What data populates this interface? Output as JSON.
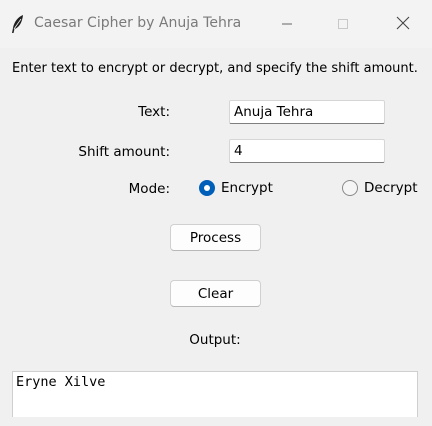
{
  "window": {
    "title": "Caesar Cipher by Anuja Tehra",
    "icon": "feather-icon",
    "controls": [
      "minimize-icon",
      "maximize-icon",
      "close-icon"
    ]
  },
  "instructions": "Enter text to encrypt or decrypt, and specify the shift amount.",
  "form": {
    "text_label": "Text:",
    "text_value": "Anuja Tehra",
    "shift_label": "Shift amount:",
    "shift_value": "4",
    "mode_label": "Mode:",
    "mode_options": [
      {
        "label": "Encrypt",
        "selected": true
      },
      {
        "label": "Decrypt",
        "selected": false
      }
    ]
  },
  "buttons": {
    "process_label": "Process",
    "clear_label": "Clear"
  },
  "output": {
    "label": "Output:",
    "value": "Eryne Xilve"
  },
  "colors": {
    "accent": "#005fb8",
    "background": "#f0f0f0"
  }
}
